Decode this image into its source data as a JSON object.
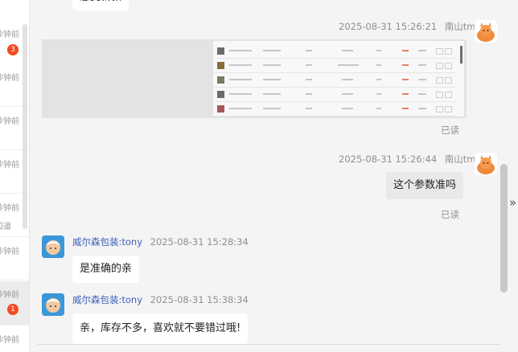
{
  "left_list": {
    "items": [
      {
        "time": "秒钟前",
        "badge": "3"
      },
      {
        "time": "秒钟前"
      },
      {
        "time": "秒钟前"
      },
      {
        "time": "秒钟前"
      },
      {
        "time": "秒钟前",
        "sub": "知道"
      },
      {
        "time": "秒钟前"
      },
      {
        "time": "秒钟前",
        "badge": "1",
        "selected": true
      },
      {
        "time": "秒钟前"
      }
    ]
  },
  "messages": {
    "top_partial_text": "感受新款",
    "m1": {
      "time": "2025-08-31 15:26:21",
      "sender": "南山tm",
      "status": "已读"
    },
    "m2": {
      "time": "2025-08-31 15:26:44",
      "sender": "南山tm",
      "text": "这个参数准吗",
      "status": "已读"
    },
    "m3": {
      "sender": "威尔森包装:tony",
      "time": "2025-08-31 15:28:34",
      "text": "是准确的亲"
    },
    "m4": {
      "sender": "威尔森包装:tony",
      "time": "2025-08-31 15:38:34",
      "text": "亲，库存不多，喜欢就不要错过哦!"
    }
  },
  "icons": {
    "expand": "»"
  },
  "colors": {
    "badge": "#f04b23",
    "sender_link": "#3d5fb8",
    "bubble_right": "#e9e9e9",
    "bubble_left": "#ffffff"
  }
}
